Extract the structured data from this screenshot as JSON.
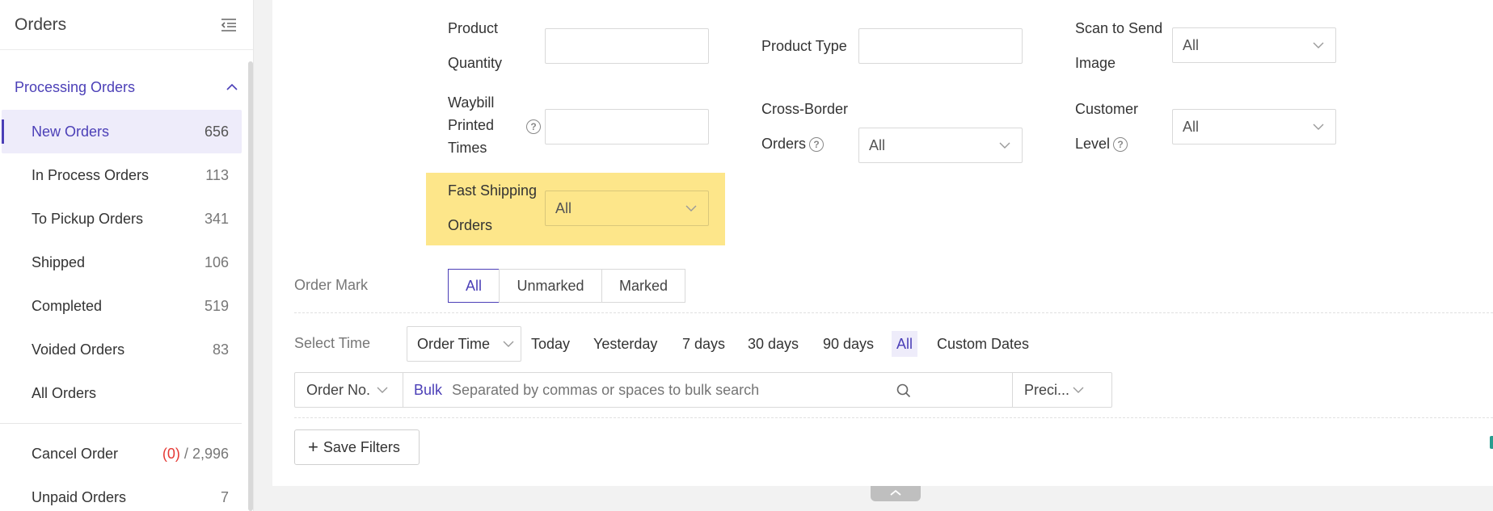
{
  "sidebar": {
    "title": "Orders",
    "group_label": "Processing Orders",
    "items": [
      {
        "label": "New Orders",
        "count": "656"
      },
      {
        "label": "In Process Orders",
        "count": "113"
      },
      {
        "label": "To Pickup Orders",
        "count": "341"
      },
      {
        "label": "Shipped",
        "count": "106"
      },
      {
        "label": "Completed",
        "count": "519"
      },
      {
        "label": "Voided Orders",
        "count": "83"
      },
      {
        "label": "All Orders",
        "count": ""
      }
    ],
    "cancel": {
      "label": "Cancel Order",
      "pending": "(0)",
      "sep": "/",
      "total": "2,996"
    },
    "unpaid": {
      "label": "Unpaid Orders",
      "count": "7"
    }
  },
  "filters": {
    "product_quantity_l1": "Product",
    "product_quantity_l2": "Quantity",
    "product_type": "Product Type",
    "scan_l1": "Scan to Send",
    "scan_l2": "Image",
    "scan_value": "All",
    "waybill_l1": "Waybill",
    "waybill_l2": "Printed",
    "waybill_l3": "Times",
    "crossborder_l1": "Cross-Border",
    "crossborder_l2": "Orders",
    "crossborder_value": "All",
    "customer_l1": "Customer",
    "customer_l2": "Level",
    "customer_value": "All",
    "fast_l1": "Fast Shipping",
    "fast_l2": "Orders",
    "fast_value": "All",
    "help_glyph": "?"
  },
  "order_mark": {
    "label": "Order Mark",
    "options": [
      "All",
      "Unmarked",
      "Marked"
    ]
  },
  "select_time": {
    "label": "Select Time",
    "dropdown": "Order Time",
    "options": [
      "Today",
      "Yesterday",
      "7 days",
      "30 days",
      "90 days",
      "All",
      "Custom Dates"
    ]
  },
  "search": {
    "field": "Order No.",
    "bulk": "Bulk",
    "placeholder": "Separated by commas or spaces to bulk search",
    "match": "Preci..."
  },
  "save_filters": {
    "icon": "+",
    "label": "Save Filters"
  },
  "colors": {
    "accent": "#4b3fb7",
    "highlight": "#fde68a",
    "danger": "#e53935"
  }
}
